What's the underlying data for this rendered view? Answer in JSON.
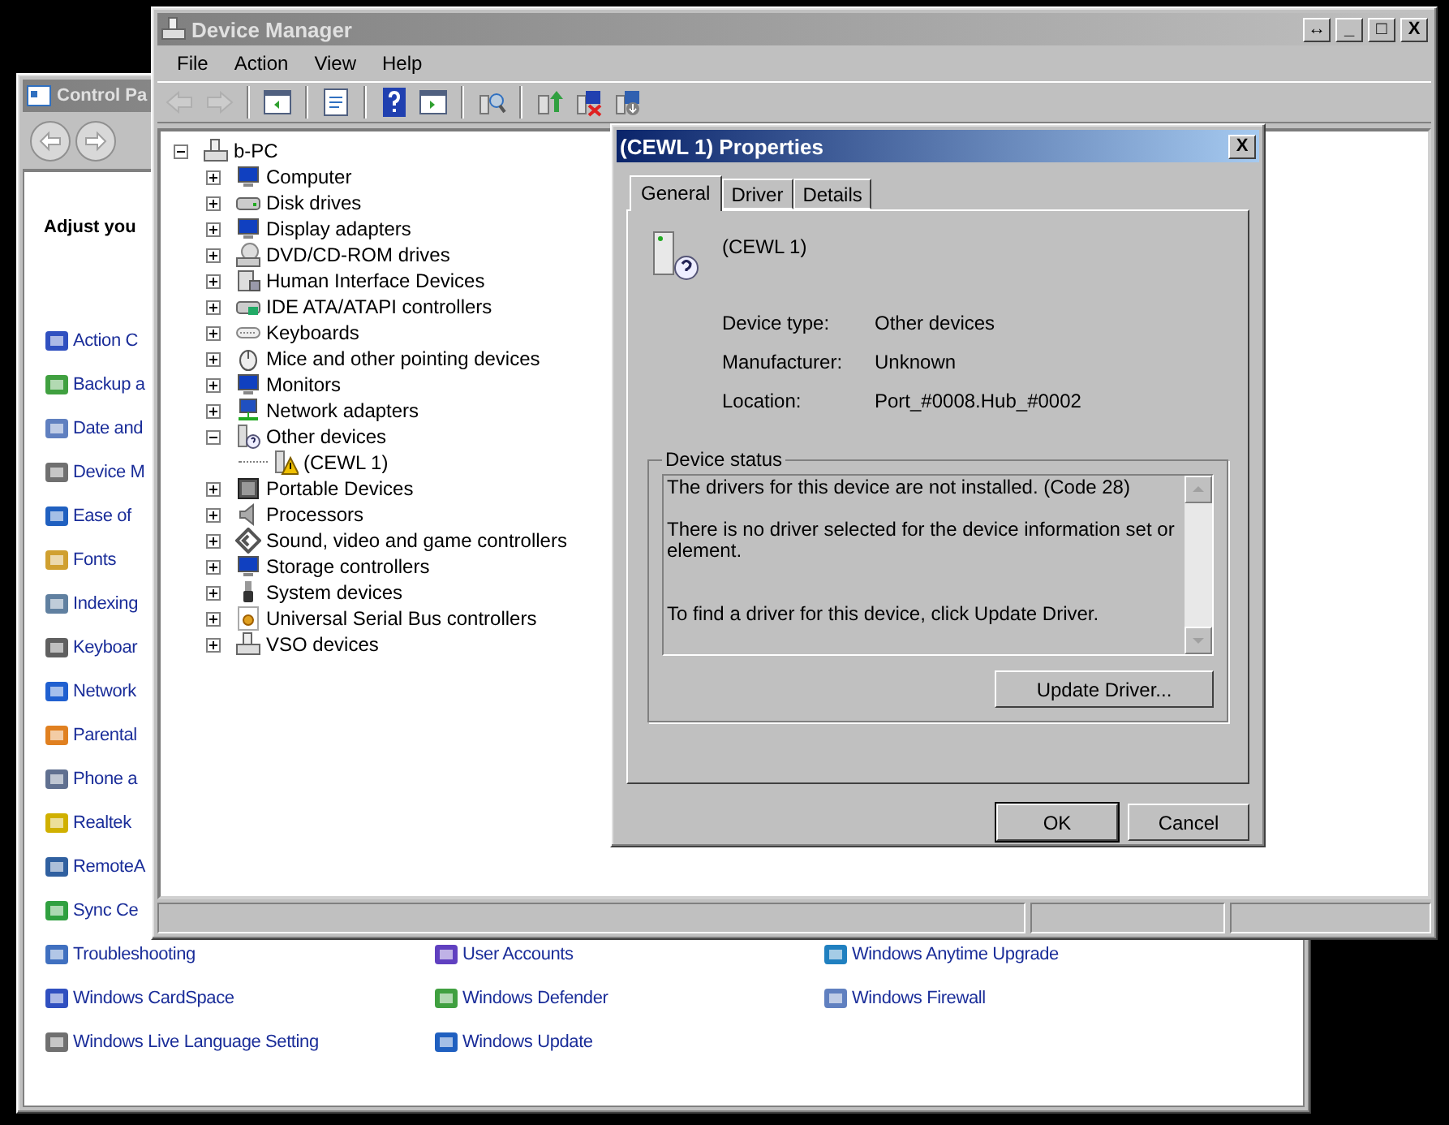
{
  "control_panel": {
    "title": "Control Pa",
    "heading": "Adjust you",
    "rows": [
      {
        "cells": [
          "Action C"
        ]
      },
      {
        "cells": [
          "Backup a"
        ]
      },
      {
        "cells": [
          "Date and"
        ]
      },
      {
        "cells": [
          "Device M"
        ]
      },
      {
        "cells": [
          "Ease of"
        ]
      },
      {
        "cells": [
          "Fonts"
        ]
      },
      {
        "cells": [
          "Indexing"
        ]
      },
      {
        "cells": [
          "Keyboar"
        ]
      },
      {
        "cells": [
          "Network"
        ]
      },
      {
        "cells": [
          "Parental"
        ]
      },
      {
        "cells": [
          "Phone a"
        ]
      },
      {
        "cells": [
          "Realtek"
        ]
      },
      {
        "cells": [
          "RemoteA"
        ]
      },
      {
        "cells": [
          "Sync Ce"
        ]
      },
      {
        "cells": [
          "Troubleshooting",
          "User Accounts",
          "Windows Anytime Upgrade"
        ]
      },
      {
        "cells": [
          "Windows CardSpace",
          "Windows Defender",
          "Windows Firewall"
        ]
      },
      {
        "cells": [
          "Windows Live Language Setting",
          "Windows Update"
        ]
      }
    ]
  },
  "device_manager": {
    "title": "Device Manager",
    "window_buttons": [
      "↔",
      "_",
      "□",
      "X"
    ],
    "menu": [
      "File",
      "Action",
      "View",
      "Help"
    ],
    "toolbar": [
      {
        "kind": "back",
        "disabled": true
      },
      {
        "kind": "forward",
        "disabled": true
      },
      {
        "kind": "sep",
        "disabled": false
      },
      {
        "kind": "panel",
        "disabled": false
      },
      {
        "kind": "sep",
        "disabled": false
      },
      {
        "kind": "sheet",
        "disabled": false
      },
      {
        "kind": "sep",
        "disabled": false
      },
      {
        "kind": "help",
        "disabled": false
      },
      {
        "kind": "panel2",
        "disabled": false
      },
      {
        "kind": "sep",
        "disabled": false
      },
      {
        "kind": "scan",
        "disabled": false
      },
      {
        "kind": "sep",
        "disabled": false
      },
      {
        "kind": "update",
        "disabled": false
      },
      {
        "kind": "uninstall",
        "disabled": false
      },
      {
        "kind": "install",
        "disabled": false
      }
    ],
    "tree": {
      "label": "b-PC",
      "kind": "group",
      "expanded": true,
      "children": [
        {
          "label": "Computer",
          "kind": "group",
          "expanded": false
        },
        {
          "label": "Disk drives",
          "kind": "group",
          "expanded": false
        },
        {
          "label": "Display adapters",
          "kind": "group",
          "expanded": false
        },
        {
          "label": "DVD/CD-ROM drives",
          "kind": "group",
          "expanded": false
        },
        {
          "label": "Human Interface Devices",
          "kind": "group",
          "expanded": false
        },
        {
          "label": "IDE ATA/ATAPI controllers",
          "kind": "group",
          "expanded": false
        },
        {
          "label": "Keyboards",
          "kind": "group",
          "expanded": false
        },
        {
          "label": "Mice and other pointing devices",
          "kind": "group",
          "expanded": false
        },
        {
          "label": "Monitors",
          "kind": "group",
          "expanded": false
        },
        {
          "label": "Network adapters",
          "kind": "group",
          "expanded": false
        },
        {
          "label": "Other devices",
          "kind": "group",
          "expanded": true,
          "children": [
            {
              "label": "(CEWL 1)",
              "kind": "leaf"
            }
          ]
        },
        {
          "label": "Portable Devices",
          "kind": "group",
          "expanded": false
        },
        {
          "label": "Processors",
          "kind": "group",
          "expanded": false
        },
        {
          "label": "Sound, video and game controllers",
          "kind": "group",
          "expanded": false
        },
        {
          "label": "Storage controllers",
          "kind": "group",
          "expanded": false
        },
        {
          "label": "System devices",
          "kind": "group",
          "expanded": false
        },
        {
          "label": "Universal Serial Bus controllers",
          "kind": "group",
          "expanded": false
        },
        {
          "label": "VSO devices",
          "kind": "group",
          "expanded": false
        }
      ]
    }
  },
  "properties": {
    "title": "(CEWL 1) Properties",
    "close": "X",
    "tabs": [
      {
        "label": "General",
        "selected": true
      },
      {
        "label": "Driver",
        "selected": false
      },
      {
        "label": "Details",
        "selected": false
      }
    ],
    "device_name": "(CEWL 1)",
    "fields": [
      {
        "label": "Device type:",
        "value": "Other devices"
      },
      {
        "label": "Manufacturer:",
        "value": "Unknown"
      },
      {
        "label": "Location:",
        "value": "Port_#0008.Hub_#0002"
      }
    ],
    "status_group": "Device status",
    "status_paragraphs": [
      "The drivers for this device are not installed. (Code 28)",
      "There is no driver selected for the device information set or element.",
      "To find a driver for this device, click Update Driver."
    ],
    "update_button": "Update Driver...",
    "buttons": [
      "OK",
      "Cancel"
    ]
  }
}
